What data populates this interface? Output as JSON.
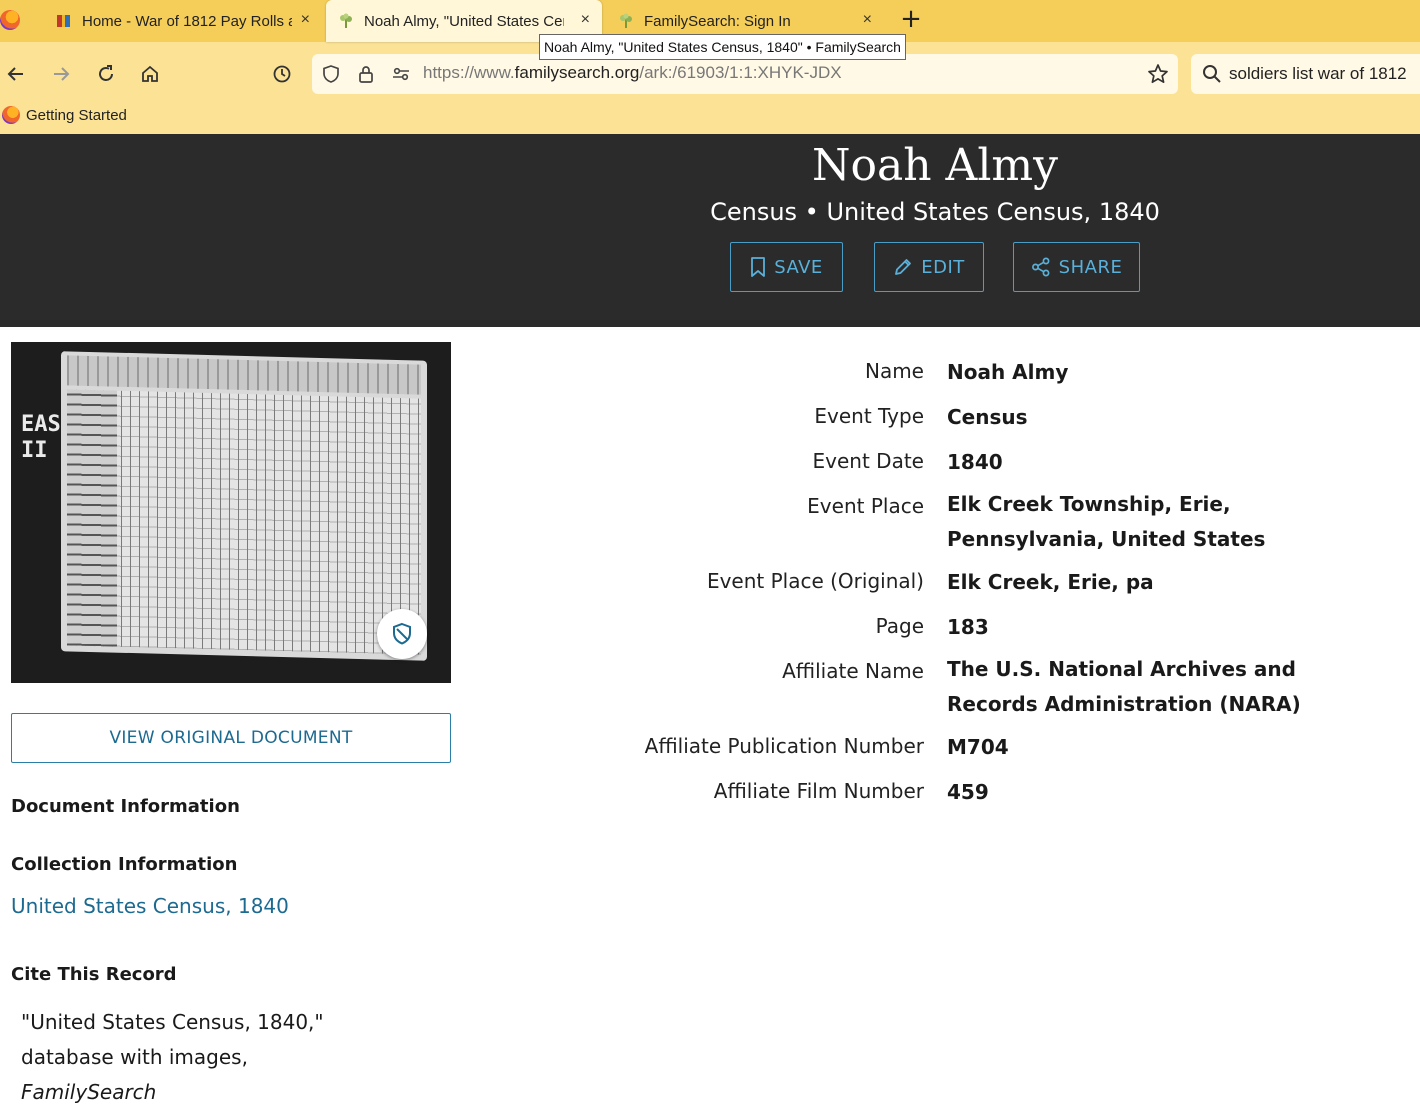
{
  "browser": {
    "tabs": [
      {
        "title": "Home - War of 1812 Pay Rolls a",
        "close": "×"
      },
      {
        "title": "Noah Almy, \"United States Cen",
        "close": "×"
      },
      {
        "title": "FamilySearch: Sign In",
        "close": "×"
      }
    ],
    "new_tab": "+",
    "tooltip": "Noah Almy, \"United States Census, 1840\" • FamilySearch",
    "url_prefix": "https://www.",
    "url_host": "familysearch.org",
    "url_path": "/ark:/61903/1:1:XHYK-JDX",
    "search_value": "soldiers list war of 1812",
    "bookmark_label": "Getting Started",
    "icons": [
      "back-icon",
      "forward-icon",
      "reload-icon",
      "home-icon",
      "history-icon",
      "shield-icon",
      "lock-icon",
      "permissions-icon",
      "star-icon",
      "search-icon"
    ]
  },
  "record": {
    "name": "Noah Almy",
    "subtitle": "Census • United States Census, 1840",
    "actions": {
      "save": "SAVE",
      "edit": "EDIT",
      "share": "SHARE"
    },
    "accent": "#5ab0d9"
  },
  "image": {
    "film_label": "EASTMAN II"
  },
  "sidebar": {
    "view_button": "VIEW ORIGINAL DOCUMENT",
    "document_info": "Document Information",
    "collection_info": "Collection Information",
    "collection_link": "United States Census, 1840",
    "cite_heading": "Cite This Record",
    "cite_lines": [
      "\"United States Census, 1840,\"",
      "database with images,",
      "FamilySearch"
    ]
  },
  "facts": [
    {
      "label": "Name",
      "value_lines": [
        "Noah Almy"
      ]
    },
    {
      "label": "Event Type",
      "value_lines": [
        "Census"
      ]
    },
    {
      "label": "Event Date",
      "value_lines": [
        "1840"
      ]
    },
    {
      "label": "Event Place",
      "value_lines": [
        "Elk Creek Township, Erie,",
        "Pennsylvania, United States"
      ]
    },
    {
      "label": "Event Place (Original)",
      "value_lines": [
        "Elk Creek, Erie, pa"
      ]
    },
    {
      "label": "Page",
      "value_lines": [
        "183"
      ]
    },
    {
      "label": "Affiliate Name",
      "value_lines": [
        "The U.S. National Archives and",
        "Records Administration (NARA)"
      ]
    },
    {
      "label": "Affiliate Publication Number",
      "value_lines": [
        "M704"
      ]
    },
    {
      "label": "Affiliate Film Number",
      "value_lines": [
        "459"
      ]
    }
  ]
}
